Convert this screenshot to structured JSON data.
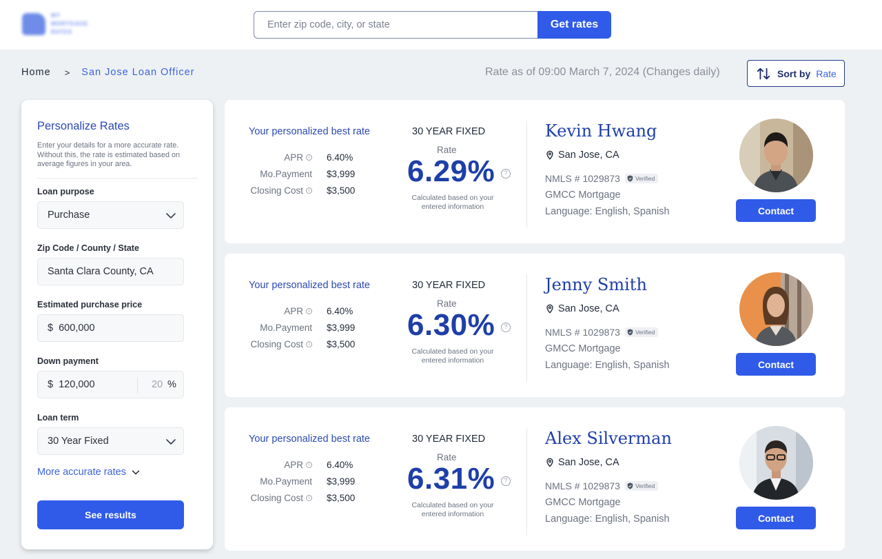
{
  "header": {
    "logo_lines": [
      "MY",
      "MORTGAGE",
      "RATES"
    ],
    "search_placeholder": "Enter zip code, city, or state",
    "get_rates_label": "Get rates"
  },
  "breadcrumb": {
    "home": "Home",
    "separator": ">",
    "current": "San Jose Loan Officer"
  },
  "rate_as_of": "Rate as of 09:00 March 7, 2024 (Changes daily)",
  "sort": {
    "label": "Sort by",
    "value": "Rate"
  },
  "sidebar": {
    "title": "Personalize Rates",
    "description": "Enter your details for a more accurate rate. Without this, the rate is estimated based on average figures in your area.",
    "loan_purpose": {
      "label": "Loan purpose",
      "value": "Purchase"
    },
    "zip": {
      "label": "Zip Code / County / State",
      "value": "Santa Clara County, CA"
    },
    "price": {
      "label": "Estimated purchase price",
      "value": "$  600,000"
    },
    "down_payment": {
      "label": "Down payment",
      "value": "$  120,000",
      "percent": "20",
      "percent_symbol": "%"
    },
    "loan_term": {
      "label": "Loan term",
      "value": "30 Year Fixed"
    },
    "more_rates": "More accurate rates",
    "see_results": "See results"
  },
  "cards": [
    {
      "best_rate_title": "Your personalized best rate",
      "apr_label": "APR",
      "apr": "6.40%",
      "payment_label": "Mo.Payment",
      "payment": "$3,999",
      "closing_label": "Closing Cost",
      "closing": "$3,500",
      "term": "30 YEAR FIXED",
      "rate_label": "Rate",
      "rate": "6.29%",
      "calc_note": "Calculated based on your entered information",
      "name": "Kevin Hwang",
      "location": "San Jose, CA",
      "nmls": "NMLS # 1029873",
      "verified": "Verified",
      "company": "GMCC Mortgage",
      "language": "Language: English, Spanish",
      "contact": "Contact"
    },
    {
      "best_rate_title": "Your personalized best rate",
      "apr_label": "APR",
      "apr": "6.40%",
      "payment_label": "Mo.Payment",
      "payment": "$3,999",
      "closing_label": "Closing Cost",
      "closing": "$3,500",
      "term": "30 YEAR FIXED",
      "rate_label": "Rate",
      "rate": "6.30%",
      "calc_note": "Calculated based on your entered information",
      "name": "Jenny Smith",
      "location": "San Jose, CA",
      "nmls": "NMLS # 1029873",
      "verified": "Verified",
      "company": "GMCC Mortgage",
      "language": "Language: English, Spanish",
      "contact": "Contact"
    },
    {
      "best_rate_title": "Your personalized best rate",
      "apr_label": "APR",
      "apr": "6.40%",
      "payment_label": "Mo.Payment",
      "payment": "$3,999",
      "closing_label": "Closing Cost",
      "closing": "$3,500",
      "term": "30 YEAR FIXED",
      "rate_label": "Rate",
      "rate": "6.31%",
      "calc_note": "Calculated based on your entered information",
      "name": "Alex Silverman",
      "location": "San Jose, CA",
      "nmls": "NMLS # 1029873",
      "verified": "Verified",
      "company": "GMCC Mortgage",
      "language": "Language: English, Spanish",
      "contact": "Contact"
    }
  ],
  "colors": {
    "accent": "#2f5be8",
    "heading_blue": "#1e3fa8",
    "page_bg": "#eef1f4"
  },
  "icons": {
    "sort": "sort-arrows-icon",
    "location": "map-pin-icon",
    "verified": "shield-check-icon",
    "info": "info-circle-icon",
    "help": "question-circle-icon",
    "chevron": "chevron-down-icon"
  }
}
